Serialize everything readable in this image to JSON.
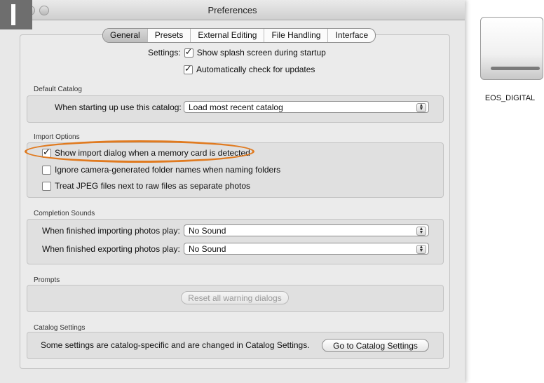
{
  "window": {
    "title": "Preferences"
  },
  "tabs": [
    "General",
    "Presets",
    "External Editing",
    "File Handling",
    "Interface"
  ],
  "settings": {
    "label": "Settings:",
    "splash": {
      "label": "Show splash screen during startup",
      "checked": true
    },
    "updates": {
      "label": "Automatically check for updates",
      "checked": true
    }
  },
  "default_catalog": {
    "group": "Default Catalog",
    "label": "When starting up use this catalog:",
    "value": "Load most recent catalog"
  },
  "import_options": {
    "group": "Import Options",
    "items": [
      {
        "label": "Show import dialog when a memory card is detected",
        "checked": true
      },
      {
        "label": "Ignore camera-generated folder names when naming folders",
        "checked": false
      },
      {
        "label": "Treat JPEG files next to raw files as separate photos",
        "checked": false
      }
    ]
  },
  "completion_sounds": {
    "group": "Completion Sounds",
    "importing_label": "When finished importing photos play:",
    "importing_value": "No Sound",
    "exporting_label": "When finished exporting photos play:",
    "exporting_value": "No Sound"
  },
  "prompts": {
    "group": "Prompts",
    "reset_button": "Reset all warning dialogs"
  },
  "catalog_settings": {
    "group": "Catalog Settings",
    "text": "Some settings are catalog-specific and are changed in Catalog Settings.",
    "button": "Go to Catalog Settings"
  },
  "desktop": {
    "drive_label": "EOS_DIGITAL"
  },
  "colors": {
    "highlight": "#e07a1f"
  }
}
